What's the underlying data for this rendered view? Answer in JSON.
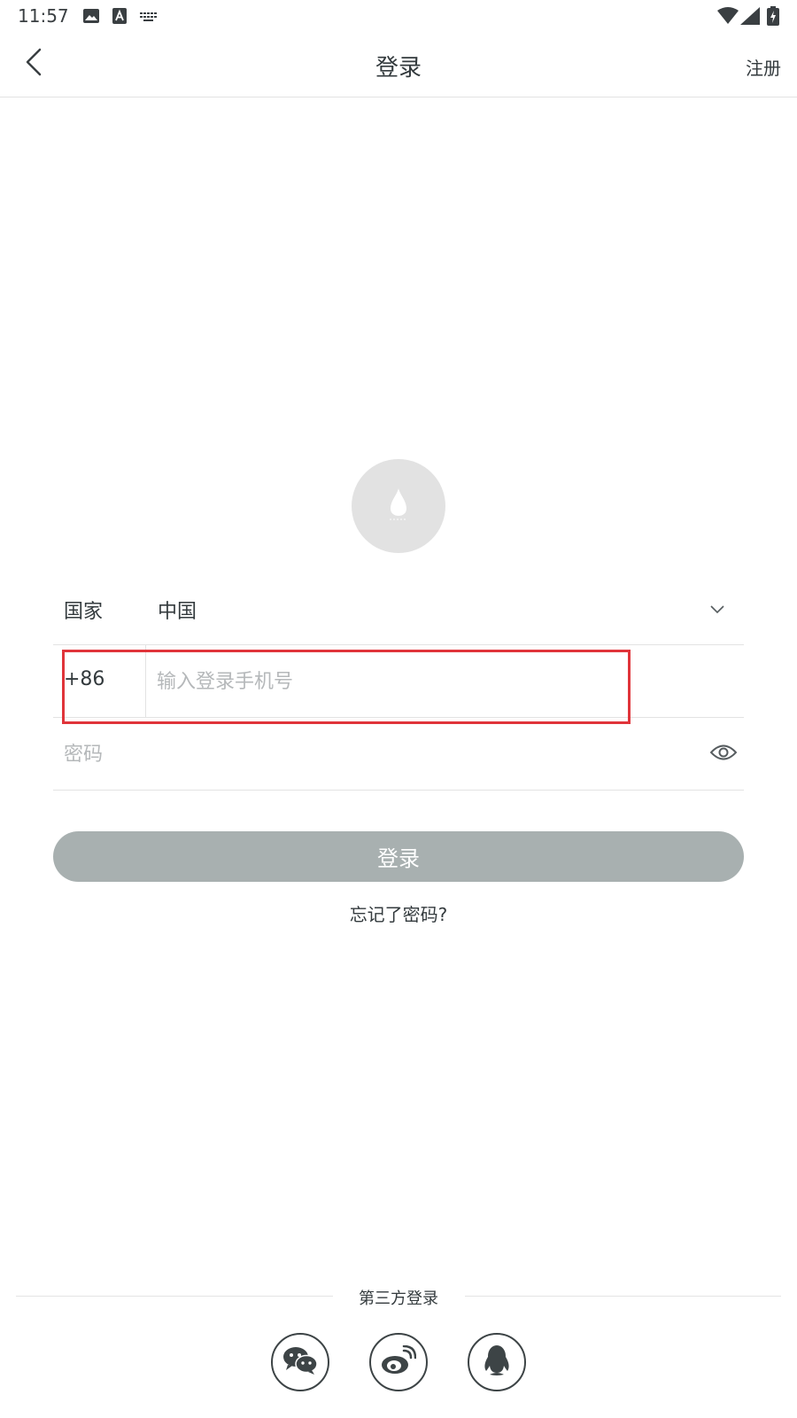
{
  "status_bar": {
    "time": "11:57",
    "icons": [
      "photo-icon",
      "a-icon",
      "keyboard-icon",
      "wifi-icon",
      "signal-icon",
      "battery-icon"
    ]
  },
  "header": {
    "title": "登录",
    "register_label": "注册",
    "back_icon": "chevron-left-icon"
  },
  "form": {
    "country_label": "国家",
    "country_value": "中国",
    "phone_prefix": "+86",
    "phone_placeholder": "输入登录手机号",
    "phone_value": "",
    "password_placeholder": "密码",
    "password_value": ""
  },
  "login_button_label": "登录",
  "forgot_password": "忘记了密码?",
  "third_party": {
    "title": "第三方登录",
    "providers": [
      "wechat-icon",
      "weibo-icon",
      "qq-icon"
    ]
  },
  "colors": {
    "text": "#333a3d",
    "placeholder": "#b5b8ba",
    "login_button_bg": "#a8b0b0",
    "highlight": "#e0343a",
    "logo_bg": "#e2e2e2"
  }
}
